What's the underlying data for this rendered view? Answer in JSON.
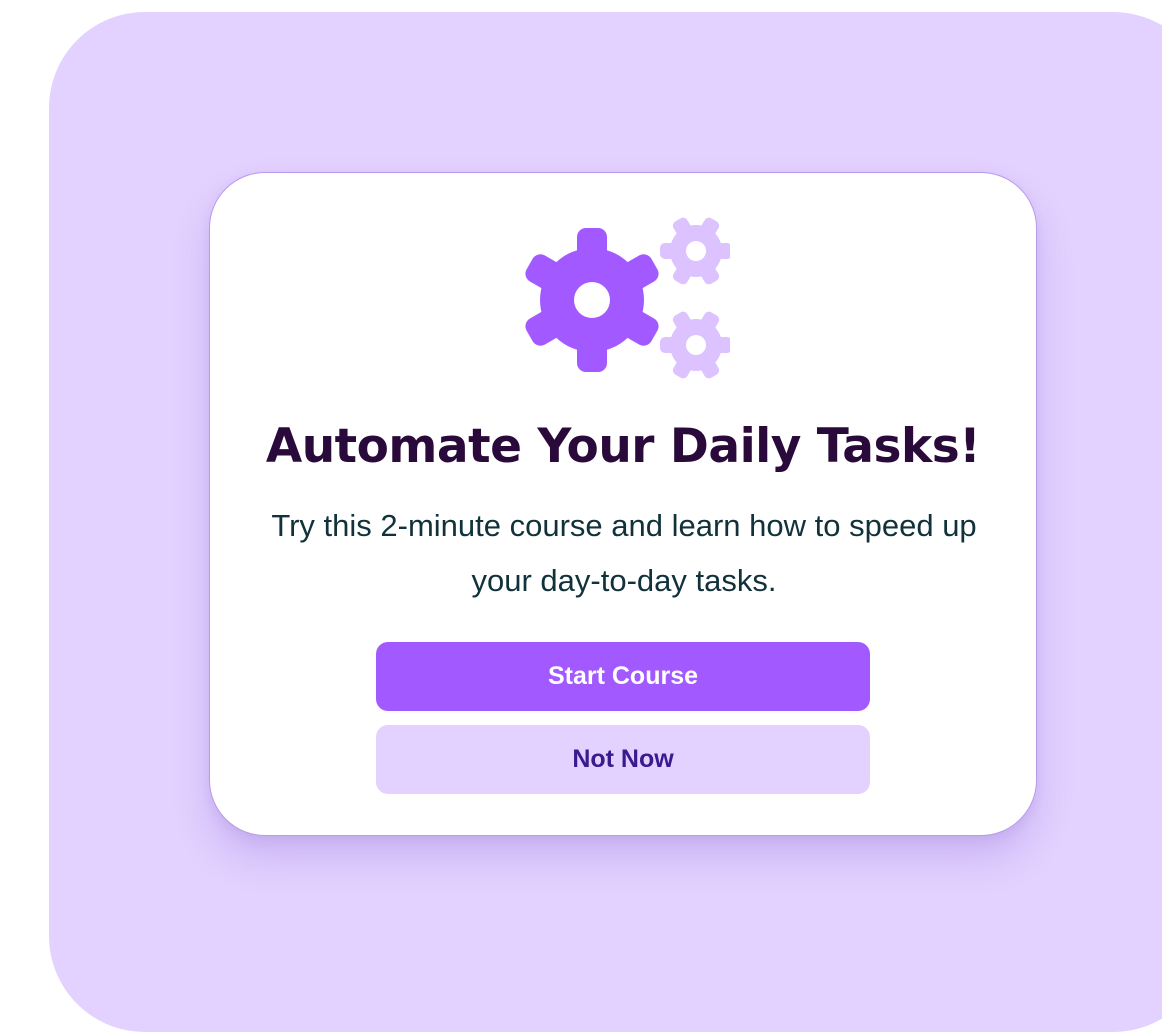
{
  "dialog": {
    "title": "Automate Your Daily Tasks!",
    "message": "Try this 2-minute course and learn how to speed up your day-to-day tasks.",
    "primary_button_label": "Start Course",
    "secondary_button_label": "Not Now",
    "icon": "gears-icon"
  },
  "colors": {
    "backdrop": "#e3d1ff",
    "card": "#ffffff",
    "accent": "#a259ff",
    "accent_light": "#dcc2ff",
    "title_text": "#2a0a3a",
    "body_text": "#12323b",
    "secondary_button_bg": "#e3d1ff",
    "secondary_button_text": "#3a1a8c"
  }
}
